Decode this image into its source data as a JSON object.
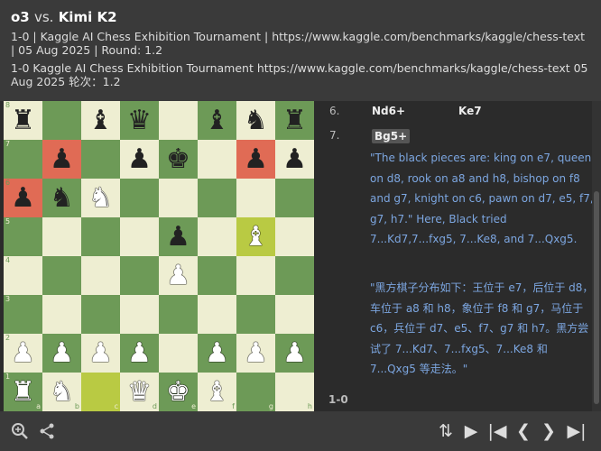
{
  "header": {
    "white_player": "o3",
    "vs": "vs.",
    "black_player": "Kimi K2",
    "meta_line1": "1-0 | Kaggle AI Chess Exhibition Tournament | https://www.kaggle.com/benchmarks/kaggle/chess-text | 05 Aug 2025 | Round: 1.2",
    "meta_line2": "1-0 Kaggle AI Chess Exhibition Tournament https://www.kaggle.com/benchmarks/kaggle/chess-text 05 Aug 2025 轮次：1.2"
  },
  "board": {
    "ranks": [
      "8",
      "7",
      "6",
      "5",
      "4",
      "3",
      "2",
      "1"
    ],
    "files": [
      "a",
      "b",
      "c",
      "d",
      "e",
      "f",
      "g",
      "h"
    ],
    "position": [
      [
        "bR",
        "",
        "bB",
        "bQ",
        "",
        "bB",
        "bN",
        "bR"
      ],
      [
        "",
        "bP",
        "",
        "bP",
        "bK",
        "",
        "bP",
        "bP"
      ],
      [
        "bP",
        "bN",
        "wN",
        "",
        "",
        "",
        "",
        ""
      ],
      [
        "",
        "",
        "",
        "",
        "bP",
        "",
        "wB",
        ""
      ],
      [
        "",
        "",
        "",
        "",
        "wP",
        "",
        "",
        ""
      ],
      [
        "",
        "",
        "",
        "",
        "",
        "",
        "",
        ""
      ],
      [
        "wP",
        "wP",
        "wP",
        "wP",
        "",
        "wP",
        "wP",
        "wP"
      ],
      [
        "wR",
        "wN",
        "",
        "wQ",
        "wK",
        "wB",
        "",
        ""
      ]
    ],
    "highlight_red": [
      "a6",
      "b7",
      "g7"
    ],
    "highlight_yellow": [
      "c1",
      "g5"
    ],
    "colors": {
      "light": "#eeeed2",
      "dark": "#6d9a57",
      "red": "#e06b55",
      "yellow": "#b9ca43"
    }
  },
  "moves": {
    "row6": {
      "num": "6.",
      "white": "Nd6+",
      "black": "Ke7"
    },
    "row7": {
      "num": "7.",
      "white": "Bg5+"
    },
    "comment_en": "\"The black pieces are: king on e7, queen on d8, rook on a8 and h8, bishop on f8 and g7, knight on c6, pawn on d7, e5, f7, g7, h7.\" Here, Black tried 7...Kd7,7...fxg5, 7...Ke8, and 7...Qxg5.",
    "comment_zh": "\"黑方棋子分布如下：王位于 e7，后位于 d8，车位于 a8 和 h8，象位于 f8 和 g7，马位于 c6，兵位于 d7、e5、f7、g7 和 h7。黑方尝试了 7...Kd7、7...fxg5、7...Ke8 和 7...Qxg5 等走法。\"",
    "result": "1-0"
  },
  "toolbar": {
    "zoom_icon": "⊕",
    "share_icon": "share",
    "flip_icon": "⇅",
    "play_icon": "▶",
    "first_icon": "|◀",
    "prev_icon": "❮",
    "next_icon": "❯",
    "last_icon": "▶|"
  }
}
